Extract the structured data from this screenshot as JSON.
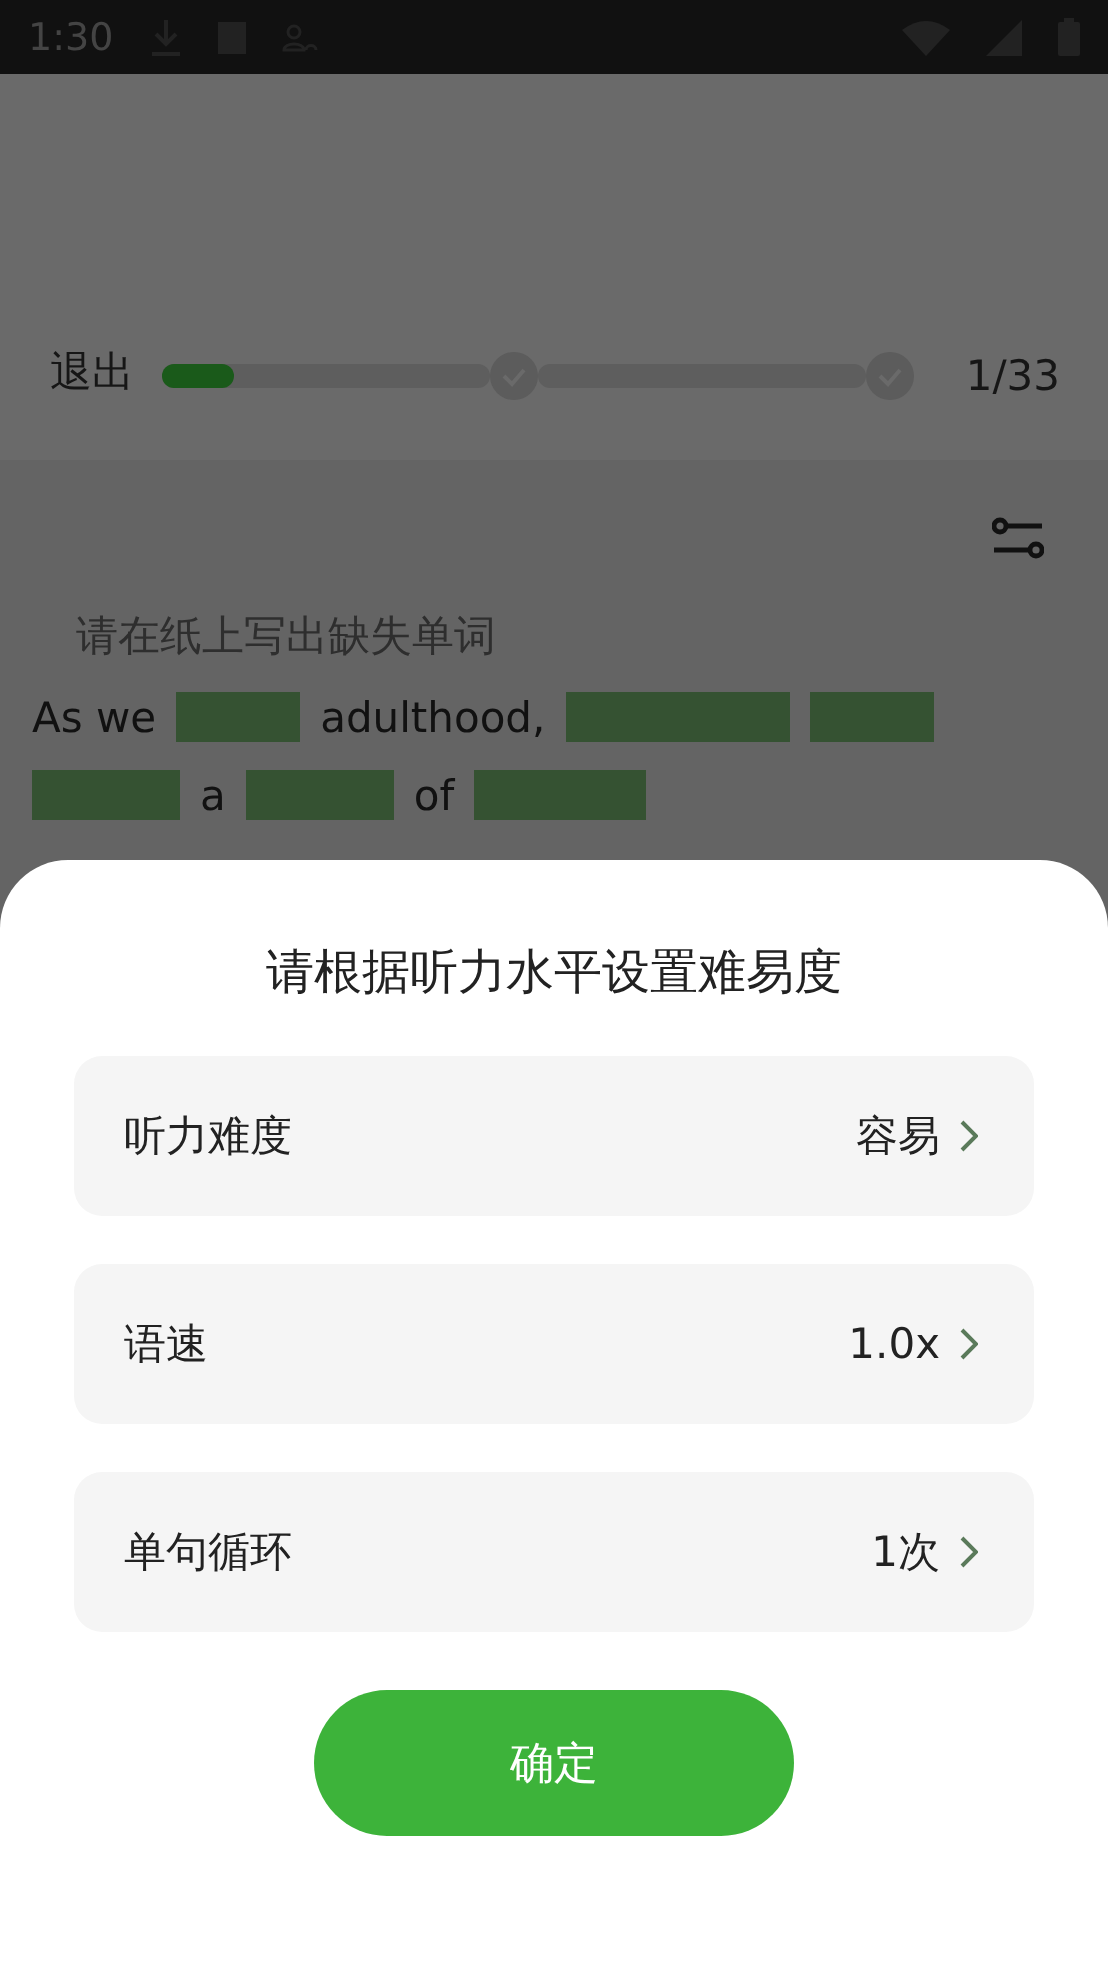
{
  "status_bar": {
    "time": "1:30"
  },
  "header": {
    "exit": "退出",
    "progress": {
      "level": 0.22
    },
    "counter": "1/33"
  },
  "hint": "请在纸上写出缺失单词",
  "sentence": [
    {
      "kind": "word",
      "text": "As we"
    },
    {
      "kind": "blank"
    },
    {
      "kind": "word",
      "text": "adulthood,"
    },
    {
      "kind": "blank"
    },
    {
      "kind": "blank"
    },
    {
      "kind": "blank"
    },
    {
      "kind": "word",
      "text": "a"
    },
    {
      "kind": "blank"
    },
    {
      "kind": "word",
      "text": "of"
    },
    {
      "kind": "blank"
    }
  ],
  "sheet": {
    "title": "请根据听力水平设置难易度",
    "settings": [
      {
        "label": "听力难度",
        "value": "容易"
      },
      {
        "label": "语速",
        "value": "1.0x"
      },
      {
        "label": "单句循环",
        "value": "1次"
      }
    ],
    "confirm": "确定"
  }
}
